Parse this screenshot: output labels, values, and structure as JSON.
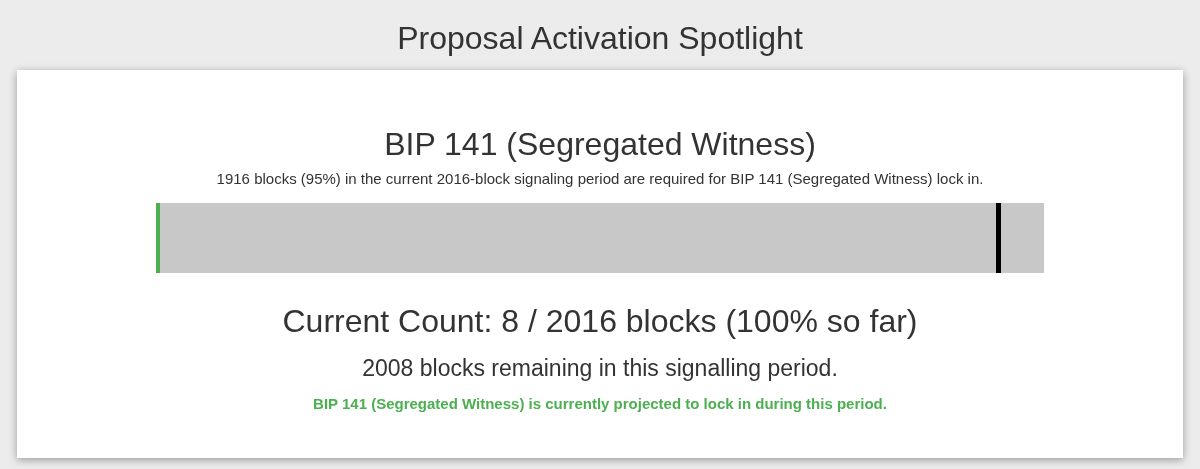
{
  "page": {
    "title": "Proposal Activation Spotlight"
  },
  "proposal": {
    "title": "BIP 141 (Segregated Witness)",
    "requirement": "1916 blocks (95%) in the current 2016-block signaling period are required for BIP 141 (Segregated Witness) lock in.",
    "progress": {
      "level": 0.004
    },
    "threshold": {
      "level": 0.946
    },
    "count": "Current Count: 8 / 2016 blocks (100% so far)",
    "remaining": "2008 blocks remaining in this signalling period.",
    "projection": "BIP 141 (Segregated Witness) is currently projected to lock in during this period."
  }
}
